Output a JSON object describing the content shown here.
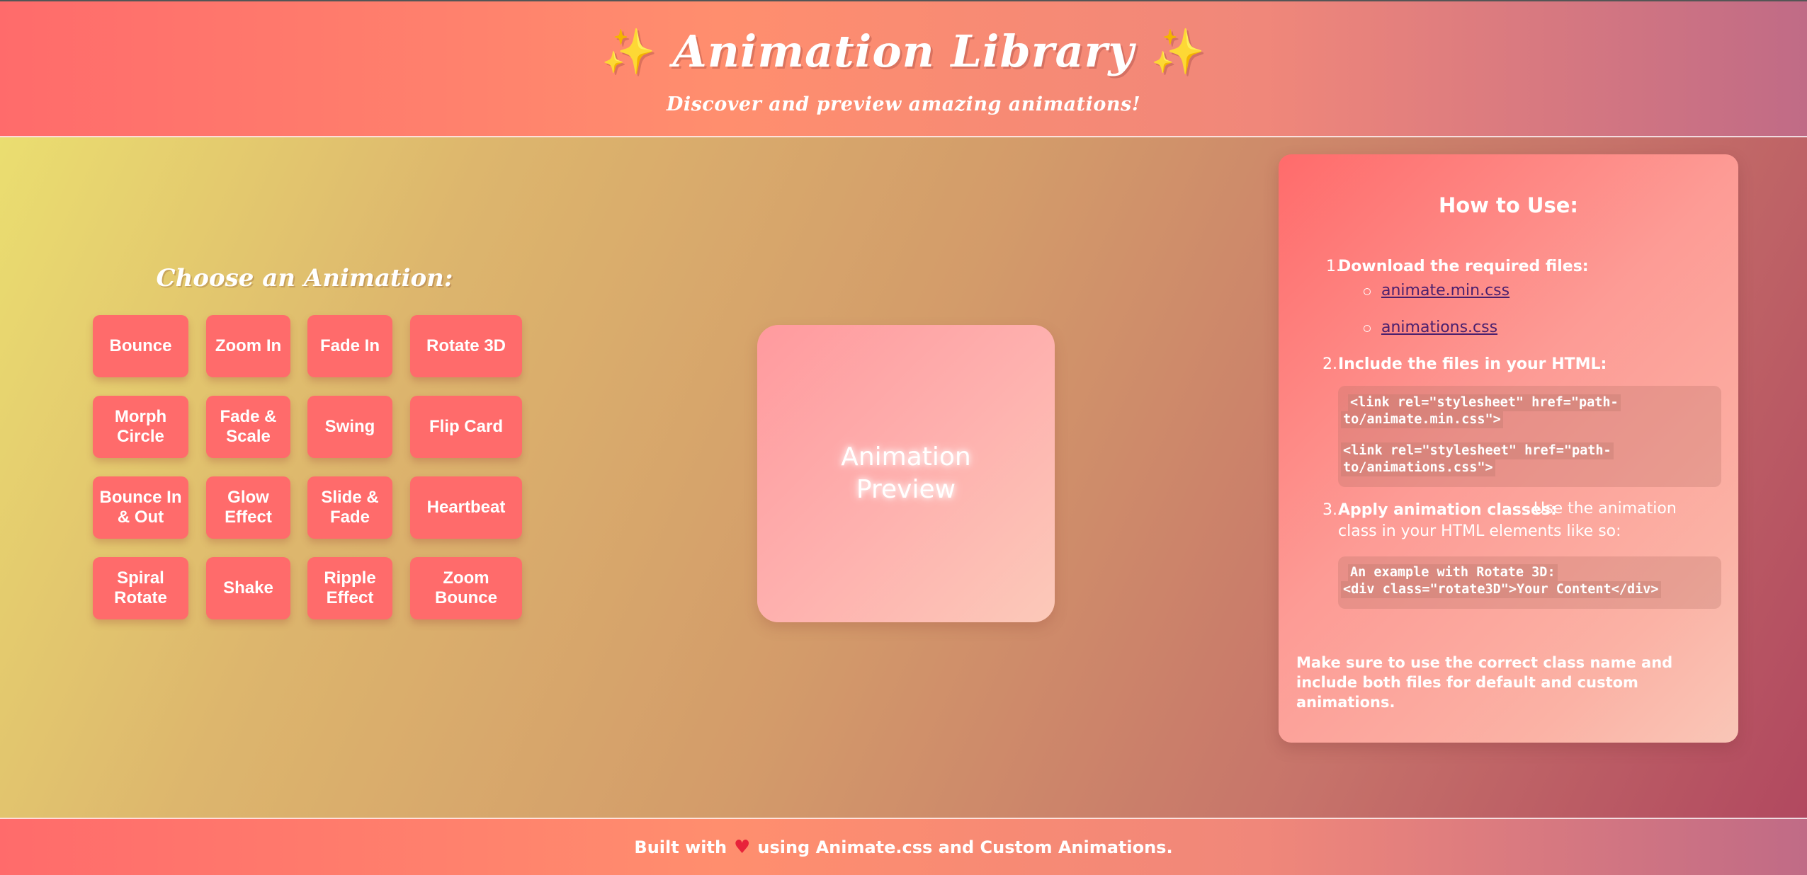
{
  "header": {
    "sparkle_left": "✨",
    "title": "Animation Library",
    "sparkle_right": "✨",
    "subtitle": "Discover and preview amazing animations!"
  },
  "animations": {
    "title": "Choose an Animation:",
    "buttons": [
      "Bounce",
      "Zoom In",
      "Fade In",
      "Rotate 3D",
      "Morph Circle",
      "Fade & Scale",
      "Swing",
      "Flip Card",
      "Bounce In & Out",
      "Glow Effect",
      "Slide & Fade",
      "Heartbeat",
      "Spiral Rotate",
      "Shake",
      "Ripple Effect",
      "Zoom Bounce"
    ]
  },
  "preview": {
    "text": "Animation Preview"
  },
  "howto": {
    "title": "How to Use:",
    "step1_num": "1.",
    "step1_label": "Download the required files:",
    "file1": "animate.min.css",
    "file2": "animations.css",
    "step2_num": "2.",
    "step2_label": "Include the files in your HTML:",
    "code1_line1": "<link rel=\"stylesheet\" href=\"path-",
    "code1_line2": "to/animate.min.css\">",
    "code1_line3": "<link rel=\"stylesheet\" href=\"path-",
    "code1_line4": "to/animations.css\">",
    "step3_num": "3.",
    "step3_label": "Apply animation classes:",
    "step3_text1": "Use the animation",
    "step3_text2": "class in your HTML elements like so:",
    "code2_line1": "An example with Rotate 3D:",
    "code2_line2": "<div class=\"rotate3D\">Your Content</div>",
    "note": "Make sure to use the correct class name and include both files for default and custom animations."
  },
  "footer": {
    "prefix": "Built with",
    "heart": "♥",
    "suffix": "using Animate.css and Custom Animations."
  },
  "colors": {
    "button": "#ff6b6b",
    "link": "#4a1f6e",
    "sparkle": "#f7c948",
    "heart": "#e8233a"
  }
}
